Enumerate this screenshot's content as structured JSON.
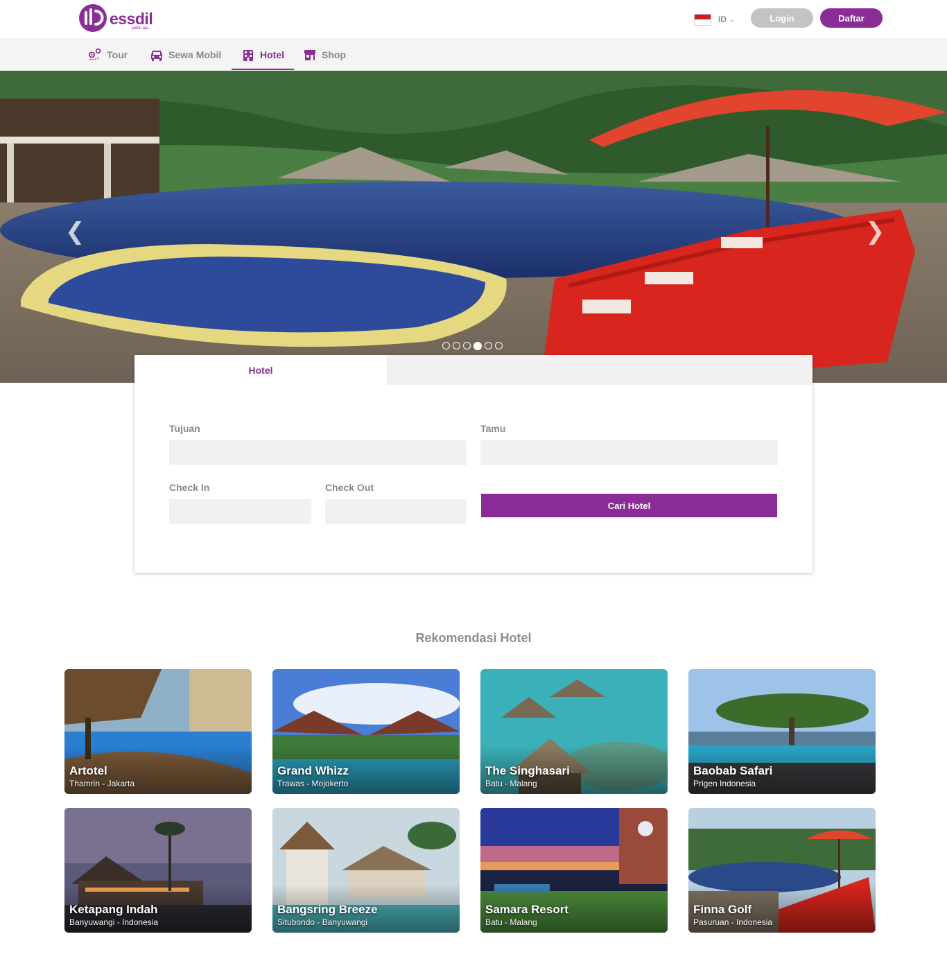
{
  "header": {
    "brand": "essdil",
    "tagline": "jadiin aja...",
    "language": "ID",
    "login_label": "Login",
    "register_label": "Daftar"
  },
  "nav": {
    "items": [
      {
        "label": "Tour",
        "icon": "map-pin-icon",
        "active": false
      },
      {
        "label": "Sewa Mobil",
        "icon": "car-icon",
        "active": false
      },
      {
        "label": "Hotel",
        "icon": "building-icon",
        "active": true
      },
      {
        "label": "Shop",
        "icon": "store-icon",
        "active": false
      }
    ]
  },
  "hero": {
    "slide_count": 6,
    "active_slide": 4
  },
  "search": {
    "tab_label": "Hotel",
    "destination_label": "Tujuan",
    "guests_label": "Tamu",
    "checkin_label": "Check In",
    "checkout_label": "Check Out",
    "submit_label": "Cari Hotel"
  },
  "recommendations": {
    "title": "Rekomendasi Hotel",
    "hotels": [
      {
        "name": "Artotel",
        "location": "Thamrin - Jakarta"
      },
      {
        "name": "Grand Whizz",
        "location": "Trawas - Mojokerto"
      },
      {
        "name": "The Singhasari",
        "location": "Batu - Malang"
      },
      {
        "name": "Baobab Safari",
        "location": "Prigen Indonesia"
      },
      {
        "name": "Ketapang Indah",
        "location": "Banyuwangi - Indonesia"
      },
      {
        "name": "Bangsring Breeze",
        "location": "Situbondo - Banyuwangi"
      },
      {
        "name": "Samara Resort",
        "location": "Batu - Malang"
      },
      {
        "name": "Finna Golf",
        "location": "Pasuruan - Indonesia"
      }
    ]
  },
  "colors": {
    "brand": "#8b2d96",
    "nav_bg": "#f4f4f4",
    "input_bg": "#f1f1f1",
    "muted_text": "#888888"
  }
}
